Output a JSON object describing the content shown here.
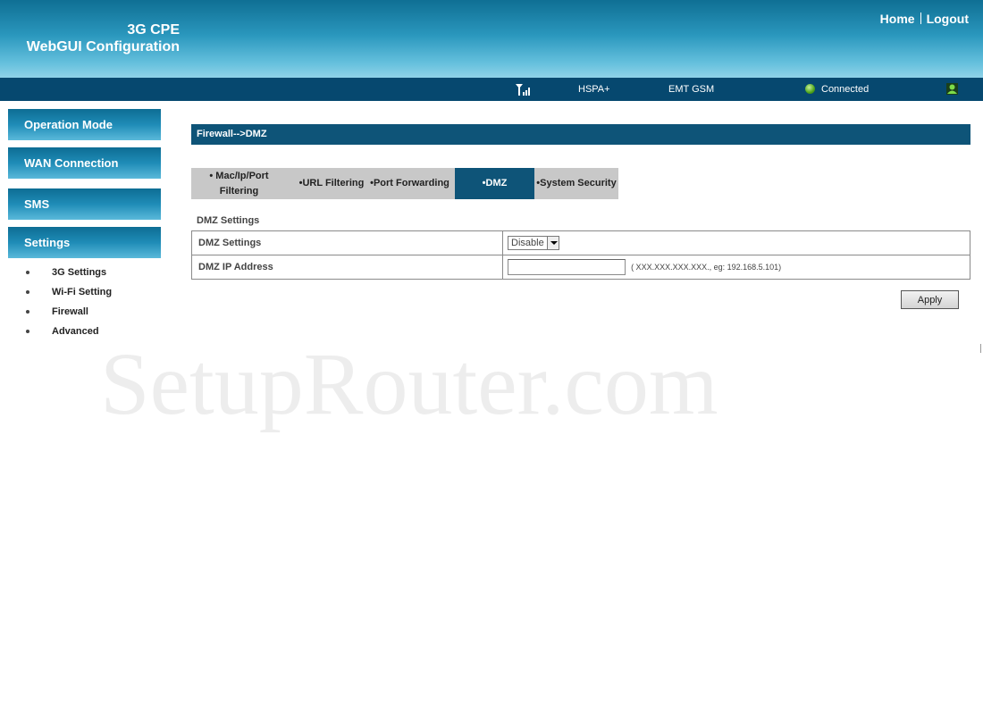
{
  "header": {
    "brand_line1": "3G CPE",
    "brand_line2": "WebGUI Configuration",
    "home_link": "Home",
    "logout_link": "Logout"
  },
  "status": {
    "signal_icon": "signal-bars-icon",
    "network_type": "HSPA+",
    "operator": "EMT GSM",
    "connection": "Connected",
    "connection_color": "#4ea41a",
    "user_icon": "user-icon"
  },
  "sidebar": {
    "menu": [
      {
        "label": "Operation Mode"
      },
      {
        "label": "WAN Connection"
      },
      {
        "label": "SMS"
      },
      {
        "label": "Settings"
      }
    ],
    "submenu": [
      {
        "label": "3G Settings"
      },
      {
        "label": "Wi-Fi Setting"
      },
      {
        "label": "Firewall"
      },
      {
        "label": "Advanced"
      }
    ]
  },
  "main": {
    "title": "Firewall-->DMZ",
    "tabs": [
      {
        "label_line1": "• Mac/Ip/Port",
        "label_line2": "Filtering"
      },
      {
        "label": "•URL Filtering"
      },
      {
        "label": "•Port Forwarding"
      },
      {
        "label": "•DMZ",
        "active": true
      },
      {
        "label": "•System Security"
      }
    ],
    "section_label": "DMZ Settings",
    "rows": [
      {
        "label": "DMZ Settings",
        "select_value": "Disable"
      },
      {
        "label": "DMZ IP Address",
        "input_value": "",
        "hint": "( XXX.XXX.XXX.XXX., eg: 192.168.5.101)"
      }
    ],
    "apply_label": "Apply"
  },
  "watermark": "SetupRouter.com",
  "colors": {
    "header_dark": "#0f6f94",
    "status_bar": "#06486f",
    "title_bar": "#0e5478",
    "tab_inactive": "#c8c8c8"
  }
}
